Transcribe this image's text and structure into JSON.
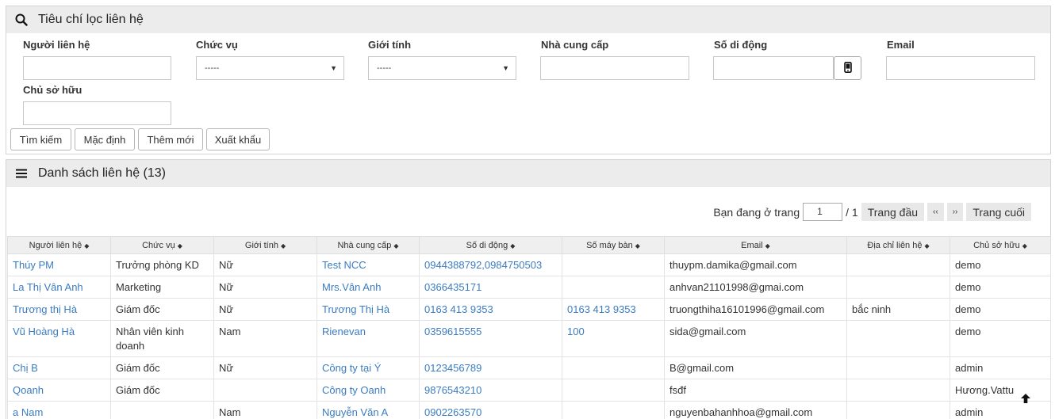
{
  "filter": {
    "title": "Tiêu chí lọc liên hệ",
    "labels": {
      "contact": "Người liên hệ",
      "position": "Chức vụ",
      "gender": "Giới tính",
      "supplier": "Nhà cung cấp",
      "mobile": "Số di động",
      "email": "Email",
      "owner": "Chủ sở hữu"
    },
    "position_value": "-----",
    "gender_value": "-----",
    "buttons": {
      "search": "Tìm kiếm",
      "default": "Mặc định",
      "add": "Thêm mới",
      "export": "Xuất khẩu"
    }
  },
  "list": {
    "title": "Danh sách liên hệ (13)",
    "pager": {
      "label": "Bạn đang ở trang",
      "page": "1",
      "total": "/ 1",
      "first": "Trang đầu",
      "prev": "‹‹",
      "next": "››",
      "last": "Trang cuối"
    },
    "columns": [
      "Người liên hệ",
      "Chức vụ",
      "Giới tính",
      "Nhà cung cấp",
      "Số di động",
      "Số máy bàn",
      "Email",
      "Địa chỉ liên hệ",
      "Chủ sở hữu"
    ],
    "rows": [
      [
        "Thúy PM",
        "Trưởng phòng KD",
        "Nữ",
        "Test NCC",
        "0944388792,0984750503",
        "",
        "thuypm.damika@gmail.com",
        "",
        "demo"
      ],
      [
        "La Thị Vân Anh",
        "Marketing",
        "Nữ",
        "Mrs.Vân Anh",
        "0366435171",
        "",
        "anhvan21101998@gmai.com",
        "",
        "demo"
      ],
      [
        "Trương thị Hà",
        "Giám đốc",
        "Nữ",
        "Trương Thị Hà",
        "0163 413 9353",
        "0163 413 9353",
        "truongthiha16101996@gmail.com",
        "bắc ninh",
        "demo"
      ],
      [
        "Vũ Hoàng Hà",
        "Nhân viên kinh doanh",
        "Nam",
        "Rienevan",
        "0359615555",
        "100",
        "sida@gmail.com",
        "",
        "demo"
      ],
      [
        "Chị B",
        "Giám đốc",
        "Nữ",
        "Công ty tại Ý",
        "0123456789",
        "",
        "B@gmail.com",
        "",
        "admin"
      ],
      [
        "Qoanh",
        "Giám đốc",
        "",
        "Công ty Oanh",
        "9876543210",
        "",
        "fsđf",
        "",
        "Hương.Vattu"
      ],
      [
        "a Nam",
        "",
        "Nam",
        "Nguyễn Văn A",
        "0902263570",
        "",
        "nguyenbahanhhoa@gmail.com",
        "",
        "admin"
      ]
    ]
  },
  "icons": {
    "filter": "search-icon",
    "list": "menu-icon",
    "mobile": "mobile-phone-icon",
    "scroll_top": "arrow-up-icon",
    "sort": "sort-icon"
  }
}
